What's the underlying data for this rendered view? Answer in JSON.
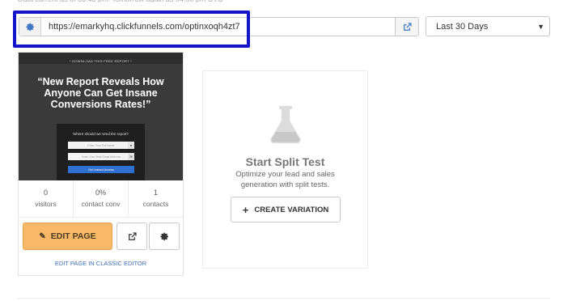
{
  "url_bar": {
    "url": "https://emarkyhq.clickfunnels.com/optinxoqh4zt7",
    "gear_icon": "gear-icon",
    "open_icon": "external-link-icon"
  },
  "date_range": {
    "selected": "Last 30 Days",
    "caret_icon": "caret-down-icon"
  },
  "page_card": {
    "thumbnail": {
      "kicker": "* DOWNLOAD THIS FREE REPORT *",
      "headline": "“New Report Reveals How Anyone Can Get Insane Conversions Rates!”",
      "form_title": "Where should we send the report?",
      "name_placeholder": "Enter Your Full Name",
      "email_placeholder": "Enter Your Best Email Address",
      "button_label": "Get Instant Access"
    },
    "stats": [
      {
        "value": "0",
        "label": "visitors"
      },
      {
        "value": "0%",
        "label": "contact conv"
      },
      {
        "value": "1",
        "label": "contacts"
      }
    ],
    "edit_button_label": "EDIT PAGE",
    "classic_link": "EDIT PAGE IN CLASSIC EDITOR"
  },
  "split_test": {
    "title": "Start Split Test",
    "description": "Optimize your lead and sales generation with split tests.",
    "button_label": "CREATE VARIATION"
  },
  "colors": {
    "highlight_border": "#1414c8",
    "edit_button": "#f7b967",
    "link": "#3f6fb8"
  }
}
